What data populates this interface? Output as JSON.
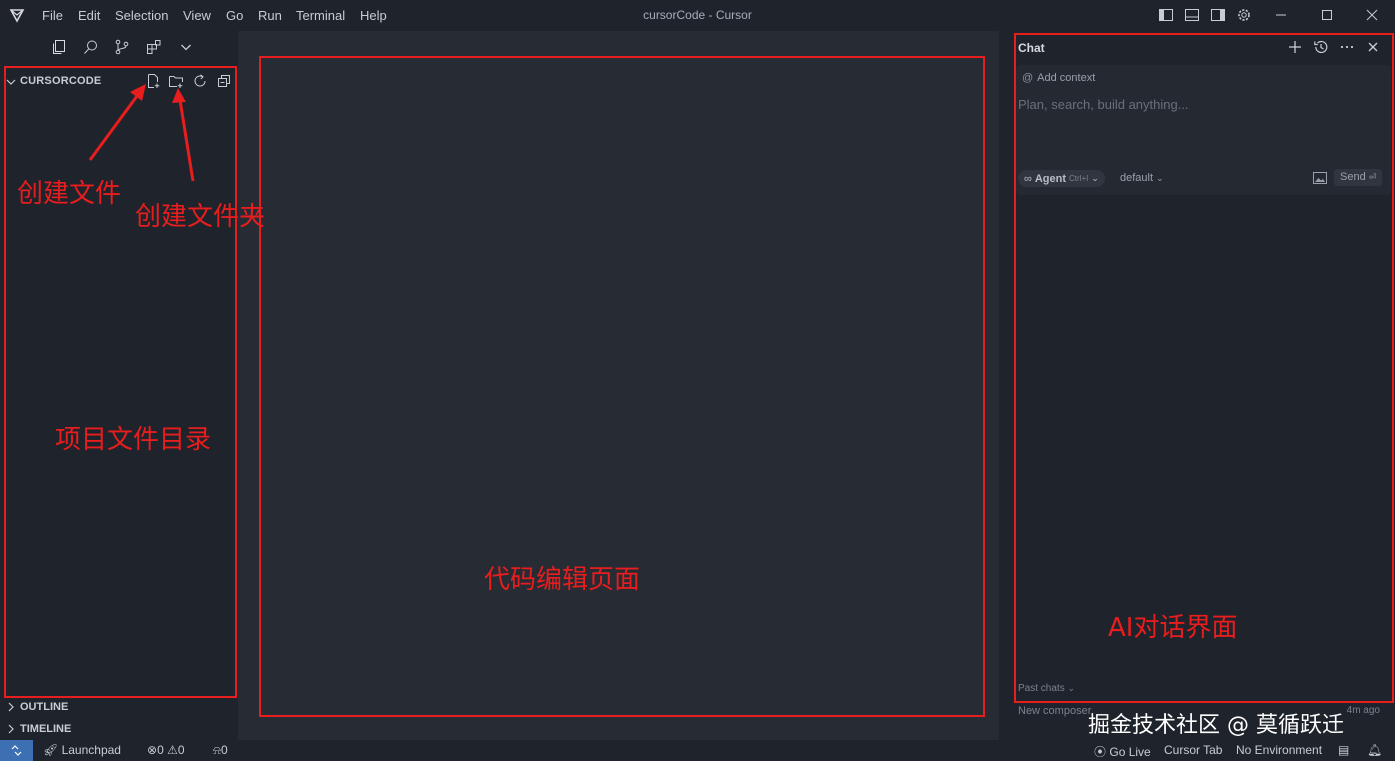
{
  "titlebar": {
    "menu": [
      "File",
      "Edit",
      "Selection",
      "View",
      "Go",
      "Run",
      "Terminal",
      "Help"
    ],
    "window_title": "cursorCode - Cursor"
  },
  "sidebar": {
    "explorer_title": "CURSORCODE",
    "sections": [
      "OUTLINE",
      "TIMELINE"
    ]
  },
  "chat": {
    "title": "Chat",
    "add_context": "Add context",
    "placeholder": "Plan, search, build anything...",
    "agent_label": "Agent",
    "agent_shortcut": "Ctrl+I",
    "model": "default",
    "send_label": "Send",
    "past_chats": "Past chats",
    "composer_name": "New composer",
    "composer_time": "4m ago"
  },
  "statusbar": {
    "launchpad": "Launchpad",
    "errors": "0",
    "warnings": "0",
    "ports": "0",
    "go_live": "Go Live",
    "cursor_tab": "Cursor Tab",
    "environment": "No Environment"
  },
  "annotations": {
    "create_file": "创建文件",
    "create_folder": "创建文件夹",
    "file_tree": "项目文件目录",
    "code_editor": "代码编辑页面",
    "ai_chat": "AI对话界面",
    "annotation_color": "#e81d1d"
  },
  "watermark": "掘金技术社区 @ 莫循跃迁",
  "colors": {
    "background": "#1f232b",
    "editor": "#272b34",
    "accent": "#3d6fb3"
  },
  "icons": [
    "cursor-logo-icon",
    "files-icon",
    "search-icon",
    "source-control-icon",
    "extensions-icon",
    "chevron-down-icon",
    "new-file-icon",
    "new-folder-icon",
    "refresh-icon",
    "collapse-all-icon",
    "plus-icon",
    "history-icon",
    "more-icon",
    "close-icon",
    "gear-icon"
  ]
}
